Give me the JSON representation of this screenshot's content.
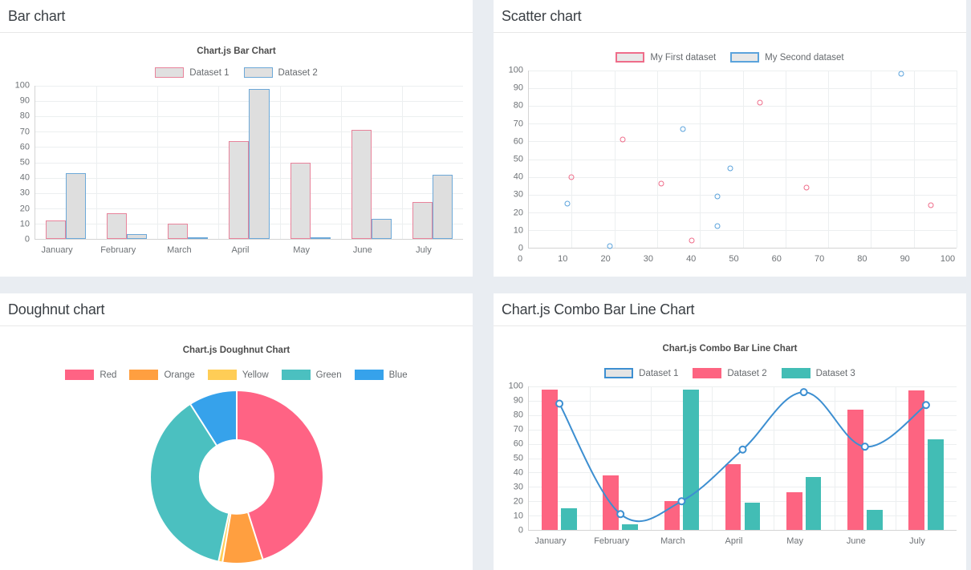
{
  "panels": {
    "bar": {
      "title": "Bar chart"
    },
    "scatter": {
      "title": "Scatter chart"
    },
    "doughnut": {
      "title": "Doughnut chart"
    },
    "combo": {
      "title": "Chart.js Combo Bar Line Chart"
    }
  },
  "colors": {
    "red": "#FF6384",
    "orange": "#FF9F40",
    "yellow": "#FFCD56",
    "green": "#4BC0C0",
    "blue": "#36A2EB",
    "bar_d1_border": "#e8839b",
    "bar_d2_border": "#6ca8d8",
    "bar_fill": "#e0e0e0",
    "scatter_s1": "#ef6d8a",
    "scatter_s2": "#5ba3dc",
    "combo_line": "#3d8fd1",
    "combo_d2": "#fd6481",
    "combo_d3": "#42bdb5",
    "page_background": "#e9edf2",
    "panel_background": "#ffffff"
  },
  "chart_data": [
    {
      "id": "bar",
      "type": "bar",
      "title": "Chart.js Bar Chart",
      "categories": [
        "January",
        "February",
        "March",
        "April",
        "May",
        "June",
        "July"
      ],
      "series": [
        {
          "name": "Dataset 1",
          "values": [
            12,
            17,
            10,
            64,
            50,
            71,
            24
          ]
        },
        {
          "name": "Dataset 2",
          "values": [
            43,
            3,
            1,
            98,
            1,
            13,
            42
          ]
        }
      ],
      "ylim": [
        0,
        100
      ],
      "yticks": [
        0,
        10,
        20,
        30,
        40,
        50,
        60,
        70,
        80,
        90,
        100
      ],
      "xlabel": "",
      "ylabel": "",
      "grid": true,
      "legend_position": "top"
    },
    {
      "id": "scatter",
      "type": "scatter",
      "title": "",
      "xlim": [
        0,
        100
      ],
      "ylim": [
        0,
        100
      ],
      "xticks": [
        0,
        10,
        20,
        30,
        40,
        50,
        60,
        70,
        80,
        90,
        100
      ],
      "yticks": [
        0,
        10,
        20,
        30,
        40,
        50,
        60,
        70,
        80,
        90,
        100
      ],
      "xlabel": "",
      "ylabel": "",
      "grid": true,
      "legend_position": "top",
      "series": [
        {
          "name": "My First dataset",
          "points": [
            [
              10,
              40
            ],
            [
              22,
              61
            ],
            [
              31,
              36
            ],
            [
              38,
              4
            ],
            [
              54,
              82
            ],
            [
              65,
              34
            ],
            [
              94,
              24
            ]
          ]
        },
        {
          "name": "My Second dataset",
          "points": [
            [
              9,
              25
            ],
            [
              19,
              1
            ],
            [
              36,
              67
            ],
            [
              44,
              12
            ],
            [
              44,
              29
            ],
            [
              47,
              45
            ],
            [
              87,
              98
            ]
          ]
        }
      ]
    },
    {
      "id": "doughnut",
      "type": "pie",
      "title": "Chart.js Doughnut Chart",
      "labels": [
        "Red",
        "Orange",
        "Yellow",
        "Green",
        "Blue"
      ],
      "values": [
        300,
        50,
        5,
        250,
        60
      ],
      "colors": [
        "#FF6384",
        "#FF9F40",
        "#FFCD56",
        "#4BC0C0",
        "#36A2EB"
      ],
      "legend_position": "top"
    },
    {
      "id": "combo",
      "type": "bar",
      "title": "Chart.js Combo Bar Line Chart",
      "categories": [
        "January",
        "February",
        "March",
        "April",
        "May",
        "June",
        "July"
      ],
      "series": [
        {
          "name": "Dataset 1",
          "kind": "line",
          "values": [
            88,
            11,
            20,
            56,
            96,
            58,
            87
          ]
        },
        {
          "name": "Dataset 2",
          "kind": "bar",
          "values": [
            98,
            38,
            20,
            46,
            26,
            84,
            97
          ]
        },
        {
          "name": "Dataset 3",
          "kind": "bar",
          "values": [
            15,
            4,
            98,
            19,
            37,
            14,
            63
          ]
        }
      ],
      "ylim": [
        0,
        100
      ],
      "yticks": [
        0,
        10,
        20,
        30,
        40,
        50,
        60,
        70,
        80,
        90,
        100
      ],
      "xlabel": "",
      "ylabel": "",
      "grid": true,
      "legend_position": "top"
    }
  ]
}
